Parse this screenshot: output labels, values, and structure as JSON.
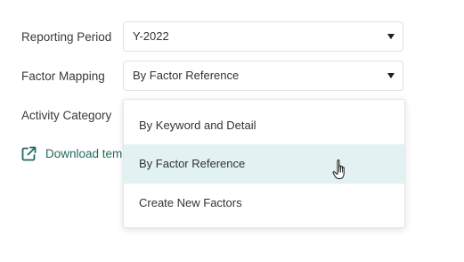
{
  "form": {
    "reporting_period": {
      "label": "Reporting Period",
      "value": "Y-2022"
    },
    "factor_mapping": {
      "label": "Factor Mapping",
      "value": "By Factor Reference"
    },
    "activity_category": {
      "label": "Activity Category"
    },
    "download_link": {
      "text": "Download template",
      "icon": "external-link-icon"
    }
  },
  "dropdown": {
    "options": [
      {
        "label": "By Keyword and Detail"
      },
      {
        "label": "By Factor Reference",
        "hovered": true
      },
      {
        "label": "Create New Factors"
      }
    ]
  },
  "colors": {
    "accent": "#1f6b5c",
    "hover_bg": "#e2f1f1",
    "border": "#e1e1e1"
  }
}
